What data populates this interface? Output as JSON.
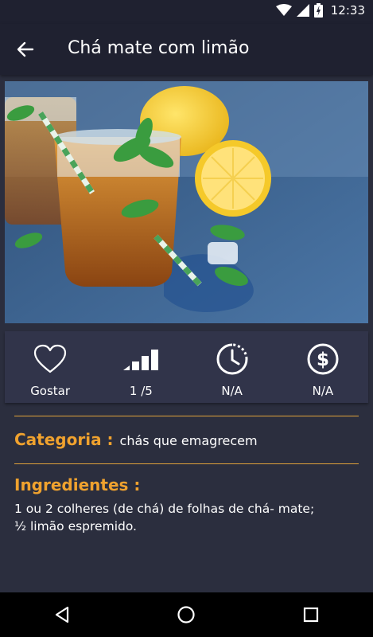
{
  "status_bar": {
    "time": "12:33"
  },
  "app_bar": {
    "title": "Chá mate com limão"
  },
  "stats": [
    {
      "label": "Gostar",
      "icon": "heart-icon"
    },
    {
      "label": "1 /5",
      "icon": "difficulty-bars-icon"
    },
    {
      "label": "N/A",
      "icon": "timer-icon"
    },
    {
      "label": "N/A",
      "icon": "dollar-icon"
    }
  ],
  "categoria": {
    "title": "Categoria :",
    "value": "chás que emagrecem"
  },
  "ingredientes": {
    "title": "Ingredientes :",
    "text": "1 ou 2 colheres (de chá) de folhas de chá- mate;\n½ limão espremido."
  },
  "colors": {
    "accent": "#f0a22e",
    "background": "#2b2e3e",
    "toolbar": "#1f2130"
  }
}
